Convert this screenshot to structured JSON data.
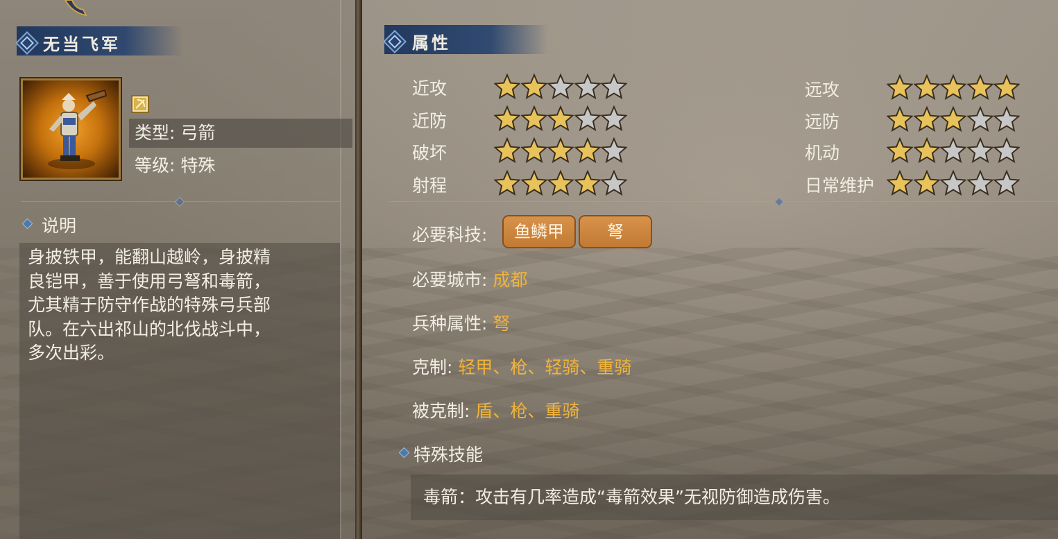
{
  "unit_name": "无当飞军",
  "attributes_title": "属性",
  "unit_info": {
    "type_label": "类型: 弓箭",
    "level_label": "等级: 特殊"
  },
  "description": {
    "title": "说明",
    "lines": [
      "身披铁甲，能翻山越岭，身披精",
      "良铠甲，善于使用弓弩和毒箭，",
      "尤其精于防守作战的特殊弓兵部",
      "队。在六出祁山的北伐战斗中，",
      "多次出彩。"
    ]
  },
  "stats_left": [
    {
      "label": "近攻",
      "rating": 2
    },
    {
      "label": "近防",
      "rating": 3
    },
    {
      "label": "破坏",
      "rating": 4
    },
    {
      "label": "射程",
      "rating": 4
    }
  ],
  "stats_right": [
    {
      "label": "远攻",
      "rating": 5
    },
    {
      "label": "远防",
      "rating": 3
    },
    {
      "label": "机动",
      "rating": 2
    },
    {
      "label": "日常维护",
      "rating": 2
    }
  ],
  "max_rating": 5,
  "required_tech": {
    "label": "必要科技:",
    "items": [
      "鱼鳞甲",
      "弩"
    ]
  },
  "required_city": {
    "label": "必要城市:",
    "value": "成都"
  },
  "unit_attribute": {
    "label": "兵种属性:",
    "value": "弩"
  },
  "counters": {
    "label": "克制:",
    "value": "轻甲、枪、轻骑、重骑"
  },
  "countered_by": {
    "label": "被克制:",
    "value": "盾、枪、重骑"
  },
  "special_skill": {
    "title": "特殊技能",
    "text": "毒箭：攻击有几率造成“毒箭效果”无视防御造成伤害。"
  },
  "colors": {
    "star_on": "#e8c25a",
    "star_off": "#c7c7c7",
    "highlight": "#f0b43c",
    "header_blue": "#1c345c"
  },
  "icons": [
    "crossbow-class-icon",
    "archer-unit-portrait",
    "star-icon"
  ]
}
